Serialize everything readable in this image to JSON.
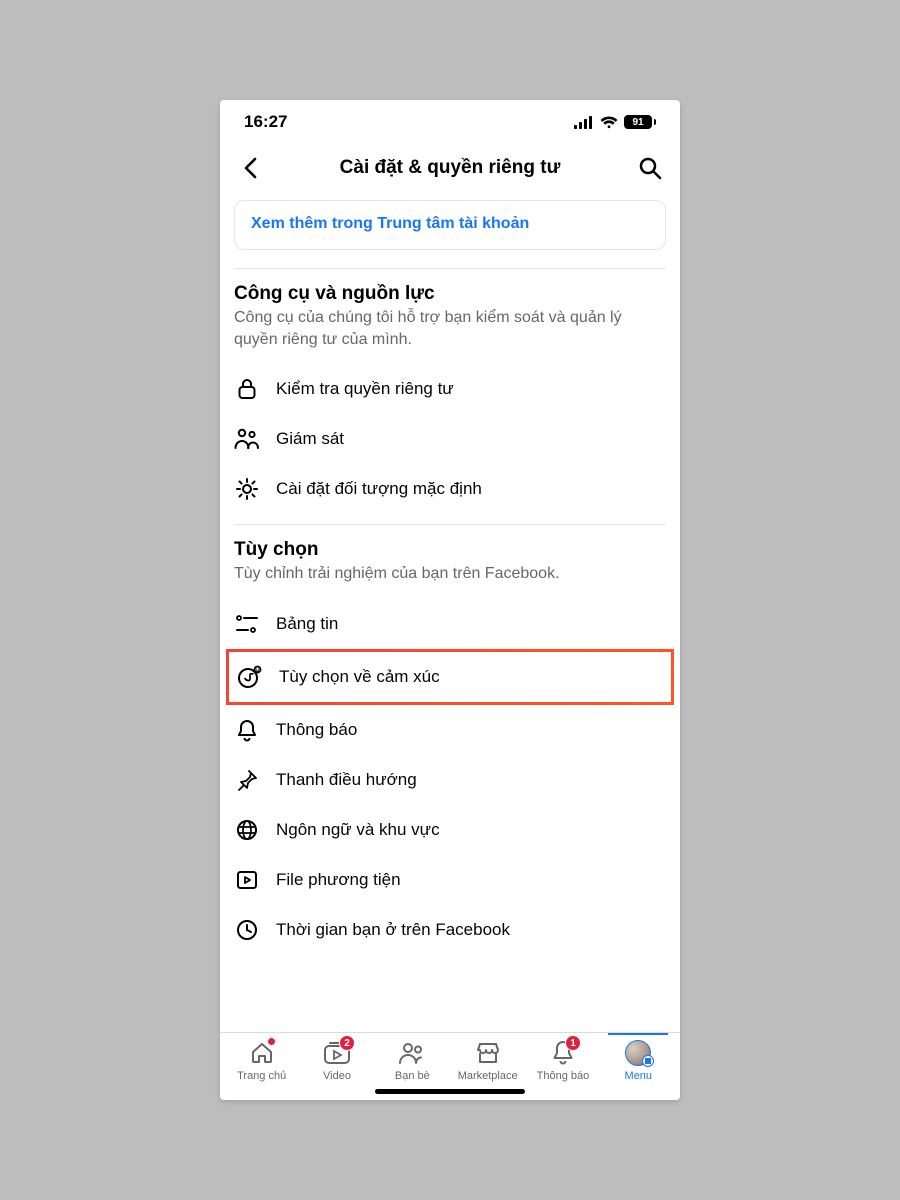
{
  "status": {
    "time": "16:27",
    "battery": "91"
  },
  "header": {
    "title": "Cài đặt & quyền riêng tư"
  },
  "card": {
    "link": "Xem thêm trong Trung tâm tài khoản"
  },
  "section_tools": {
    "title": "Công cụ và nguồn lực",
    "subtitle": "Công cụ của chúng tôi hỗ trợ bạn kiểm soát và quản lý quyền riêng tư của mình.",
    "items": [
      "Kiểm tra quyền riêng tư",
      "Giám sát",
      "Cài đặt đối tượng mặc định"
    ]
  },
  "section_prefs": {
    "title": "Tùy chọn",
    "subtitle": "Tùy chỉnh trải nghiệm của bạn trên Facebook.",
    "items": [
      "Bảng tin",
      "Tùy chọn về cảm xúc",
      "Thông báo",
      "Thanh điều hướng",
      "Ngôn ngữ và khu vực",
      "File phương tiện",
      "Thời gian bạn ở trên Facebook"
    ]
  },
  "tabs": {
    "home": "Trang chủ",
    "video": "Video",
    "friends": "Bạn bè",
    "marketplace": "Marketplace",
    "notifications": "Thông báo",
    "menu": "Menu",
    "video_badge": "2",
    "notif_badge": "1"
  }
}
